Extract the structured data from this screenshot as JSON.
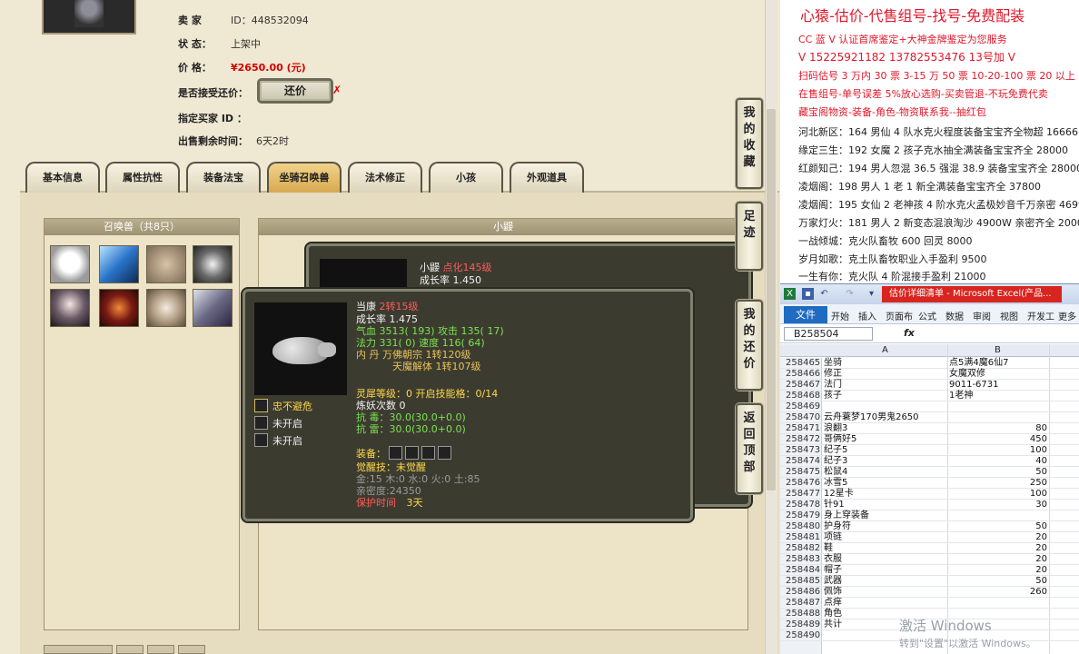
{
  "listing": {
    "seller_label": "卖  家",
    "seller_id": "ID：448532094",
    "status_label": "状        态：",
    "status_value": "上架中",
    "price_label": "价        格：",
    "price_value": "¥2650.00 (元)",
    "bargain_label": "是否接受还价：",
    "bargain_button": "还价",
    "bargain_mark": "✗",
    "buyer_label": "指定买家 ID ：",
    "remaining_label": "出售剩余时间：",
    "remaining_value": "6天2时"
  },
  "tabs": [
    {
      "label": "基本信息",
      "active": false
    },
    {
      "label": "属性抗性",
      "active": false
    },
    {
      "label": "装备法宝",
      "active": false
    },
    {
      "label": "坐骑召唤兽",
      "active": true
    },
    {
      "label": "法术修正",
      "active": false
    },
    {
      "label": "小孩",
      "active": false
    },
    {
      "label": "外观道具",
      "active": false
    }
  ],
  "pet_panel": {
    "title": "召唤兽（共8只）",
    "pets": [
      "bear-pet",
      "ice-pet",
      "owl-pet",
      "spirit-pet",
      "lady-pet",
      "fire-pet",
      "mask-pet",
      "dragon-pet"
    ]
  },
  "right_panel": {
    "title": "小鼹"
  },
  "tip_back": {
    "name": "小鼹",
    "name_extra": "点化145级",
    "growth": "成长率 1.450"
  },
  "tip_front": {
    "name": "当康",
    "name_extra": "2转15级",
    "growth": "成长率 1.475",
    "hp": "气血 3513( 193) 攻击 135( 17)",
    "mp": "法力 331( 0) 速度 116( 64)",
    "inner1": "内   丹  万佛朝宗 1转120级",
    "inner2": "天魔解体 1转107级",
    "skill1": "忠不避危",
    "skill2": "未开启",
    "skill3": "未开启",
    "spirit": "灵犀等级：0 开启技能格：0/14",
    "refine": "炼妖次数 0",
    "resist1": "抗    毒：30.0(30.0+0.0)",
    "resist2": "抗    雷：30.0(30.0+0.0)",
    "equip_label": "装备：",
    "awaken": "觉醒技：未觉醒",
    "elements": "金:15 木:0 水:0 火:0 土:85",
    "intimacy": "亲密度:24350",
    "protect_label": "保护时间",
    "protect_value": "3天"
  },
  "side_buttons": [
    {
      "label": "我的收藏",
      "chars": [
        "我",
        "的",
        "收",
        "藏"
      ]
    },
    {
      "label": "足迹",
      "chars": [
        "足",
        "迹"
      ]
    },
    {
      "label": "我的还价",
      "chars": [
        "我",
        "的",
        "还",
        "价"
      ]
    },
    {
      "label": "返回顶部",
      "chars": [
        "返",
        "回",
        "顶",
        "部"
      ]
    }
  ],
  "ads": {
    "headline": "心猿-估价-代售组号-找号-免费配装",
    "lines": [
      {
        "text": "CC 蓝 V 认证首席鉴定+大神金牌鉴定为您服务",
        "style": "red"
      },
      {
        "text": "V 15225921182    13782553476    13号加 V",
        "style": "red-big"
      },
      {
        "text": "扫码估号 3 万内 30 票 3-15 万 50 票  10-20-100 票  20 以上 150",
        "style": "red"
      },
      {
        "text": "在售组号-单号误差 5%放心选购-买卖管退-不玩免费代卖",
        "style": "red"
      },
      {
        "text": "藏宝阁物资-装备-角色-物资联系我--抽红包",
        "style": "red"
      },
      {
        "text": "河北新区：164 男仙 4 队水克火程度装备宝宝齐全物超 16666",
        "style": "black"
      },
      {
        "text": "缘定三生：192 女魔 2 孩子克水抽全满装备宝宝齐全 28000",
        "style": "black"
      },
      {
        "text": "红颜知己：194 男人忽混 36.5 强混 38.9 装备宝宝齐全 28000",
        "style": "black"
      },
      {
        "text": "凌烟阁：198 男人 1 老 1 新全满装备宝宝齐全 37800",
        "style": "black"
      },
      {
        "text": "凌烟阁：195 女仙 2 老神孩 4 阶水克火孟极妙音千万亲密 46999",
        "style": "black"
      },
      {
        "text": "万家灯火：181 男人 2 新变态混浪淘沙 4900W 亲密齐全 20000",
        "style": "black"
      },
      {
        "text": "一战倾城：克火队畜牧 600 回灵 8000",
        "style": "black"
      },
      {
        "text": "岁月如歌：克土队畜牧职业入手盈利 9500",
        "style": "black"
      },
      {
        "text": "一生有你：克火队 4 阶混接手盈利 21000",
        "style": "black"
      }
    ]
  },
  "excel": {
    "doc_title": "估价详细清单 - Microsoft Excel(产品...",
    "file_tab": "文件",
    "menu": [
      "开始",
      "插入",
      "页面布",
      "公式",
      "数据",
      "审阅",
      "视图",
      "开发工",
      "更多"
    ],
    "name_box": "B258504",
    "fx": "fx",
    "col_a": "A",
    "col_b": "B",
    "rows": [
      {
        "n": "258465",
        "a": "坐骑",
        "b": "点5满4魔6仙7",
        "v": ""
      },
      {
        "n": "258466",
        "a": "修正",
        "b": "女魔双修",
        "v": ""
      },
      {
        "n": "258467",
        "a": "法门",
        "b": "9011-6731",
        "v": ""
      },
      {
        "n": "258468",
        "a": "孩子",
        "b": "1老神",
        "v": ""
      },
      {
        "n": "258469",
        "a": "",
        "b": "",
        "v": ""
      },
      {
        "n": "258470",
        "a": "云舟蓑梦170男鬼2650",
        "b": "",
        "v": ""
      },
      {
        "n": "258471",
        "a": "浪翻3",
        "b": "",
        "v": "80"
      },
      {
        "n": "258472",
        "a": "哥俩好5",
        "b": "",
        "v": "450"
      },
      {
        "n": "258473",
        "a": "纪子5",
        "b": "",
        "v": "100"
      },
      {
        "n": "258474",
        "a": "纪子3",
        "b": "",
        "v": "40"
      },
      {
        "n": "258475",
        "a": "松鼠4",
        "b": "",
        "v": "50"
      },
      {
        "n": "258476",
        "a": "冰雪5",
        "b": "",
        "v": "250"
      },
      {
        "n": "258477",
        "a": "12星卡",
        "b": "",
        "v": "100"
      },
      {
        "n": "258478",
        "a": "针91",
        "b": "",
        "v": "30"
      },
      {
        "n": "258479",
        "a": "身上穿装备",
        "b": "",
        "v": ""
      },
      {
        "n": "258480",
        "a": "护身符",
        "b": "",
        "v": "50"
      },
      {
        "n": "258481",
        "a": "项链",
        "b": "",
        "v": "20"
      },
      {
        "n": "258482",
        "a": "鞋",
        "b": "",
        "v": "20"
      },
      {
        "n": "258483",
        "a": "衣服",
        "b": "",
        "v": "20"
      },
      {
        "n": "258484",
        "a": "帽子",
        "b": "",
        "v": "20"
      },
      {
        "n": "258485",
        "a": "武器",
        "b": "",
        "v": "50"
      },
      {
        "n": "258486",
        "a": "佩饰",
        "b": "",
        "v": "260"
      },
      {
        "n": "258487",
        "a": "点痒",
        "b": "",
        "v": ""
      },
      {
        "n": "258488",
        "a": "角色",
        "b": "",
        "v": ""
      },
      {
        "n": "258489",
        "a": "共计",
        "b": "",
        "v": ""
      },
      {
        "n": "258490",
        "a": "",
        "b": "",
        "v": ""
      }
    ]
  },
  "watermark": {
    "line1": "激活 Windows",
    "line2": "转到\"设置\"以激活 Windows。"
  }
}
